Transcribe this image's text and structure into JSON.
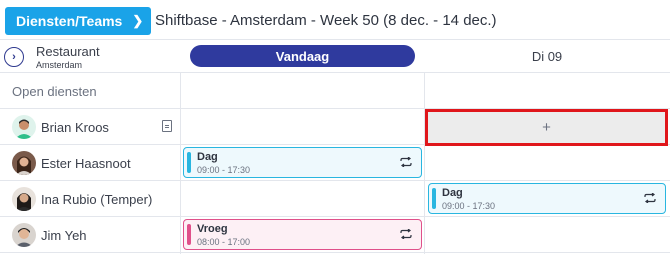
{
  "topbar": {
    "teams_button": "Diensten/Teams",
    "title": "Shiftbase - Amsterdam - Week 50 (8 dec. - 14 dec.)"
  },
  "department": {
    "name": "Restaurant",
    "location": "Amsterdam"
  },
  "columns": {
    "today": "Vandaag",
    "day2": "Di 09"
  },
  "rows": {
    "open_shifts": "Open diensten",
    "employees": [
      {
        "name": "Brian Kroos"
      },
      {
        "name": "Ester Haasnoot"
      },
      {
        "name": "Ina Rubio (Temper)"
      },
      {
        "name": "Jim Yeh"
      }
    ]
  },
  "shifts": [
    {
      "name": "Dag",
      "time": "09:00 - 17:30",
      "color": "#29b6e0"
    },
    {
      "name": "Dag",
      "time": "09:00 - 17:30",
      "color": "#29b6e0"
    },
    {
      "name": "Vroeg",
      "time": "08:00 - 17:00",
      "color": "#e0508a"
    }
  ],
  "add_cell": {
    "symbol": "+"
  },
  "colors": {
    "accent_blue": "#1aa3e8",
    "today_pill": "#2f3a9e",
    "highlight_border": "#e0161b"
  }
}
